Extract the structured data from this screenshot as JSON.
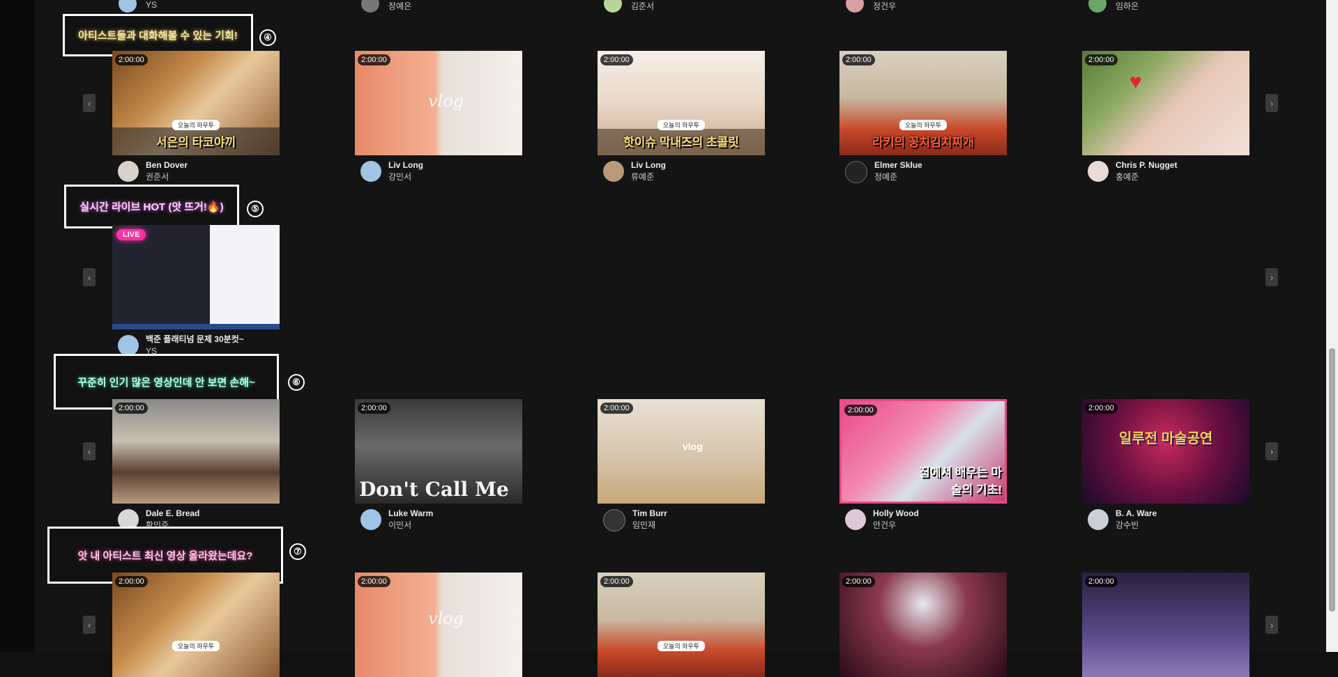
{
  "top_row": {
    "artists": [
      "YS",
      "장예은",
      "김준서",
      "정건우",
      "임하은"
    ]
  },
  "rows": [
    {
      "number": "④",
      "title": "아티스트들과 대화해볼 수 있는 기회!",
      "title_color": "#f6e9a8",
      "cards": [
        {
          "duration": "2:00:00",
          "tag": "오늘의 하우투",
          "caption": "서은의 타코야끼",
          "user": "Ben Dover",
          "artist": "권준서"
        },
        {
          "duration": "2:00:00",
          "tag": "",
          "caption": "vlog",
          "user": "Liv Long",
          "artist": "강민서"
        },
        {
          "duration": "2:00:00",
          "tag": "오늘의 하우투",
          "caption": "핫이슈 막내즈의 초콜릿",
          "user": "Liv Long",
          "artist": "류예준"
        },
        {
          "duration": "2:00:00",
          "tag": "오늘의 하우투",
          "caption": "라키의 꽁치김치찌개",
          "user": "Elmer Sklue",
          "artist": "정예준"
        },
        {
          "duration": "2:00:00",
          "tag": "",
          "caption": "",
          "user": "Chris P. Nugget",
          "artist": "홍예준"
        }
      ]
    },
    {
      "number": "⑤",
      "title": "실시간 라이브 HOT (앗 뜨거!🔥)",
      "title_color": "#ffd6ff",
      "cards": [
        {
          "live": "LIVE",
          "user": "백준 플래티넘 문제 30분컷~",
          "artist": "YS"
        }
      ]
    },
    {
      "number": "⑥",
      "title": "꾸준히 인기 많은 영상인데 안 보면 손해~",
      "title_color": "#b8ffe6",
      "cards": [
        {
          "duration": "2:00:00",
          "caption": "",
          "user": "Dale E. Bread",
          "artist": "황민준"
        },
        {
          "duration": "2:00:00",
          "caption": "Don't Call Me",
          "user": "Luke Warm",
          "artist": "이민서"
        },
        {
          "duration": "2:00:00",
          "caption": "vlog",
          "user": "Tim Burr",
          "artist": "임민재"
        },
        {
          "duration": "2:00:00",
          "caption": "집에서 배우는 마술의 기초!",
          "user": "Holly Wood",
          "artist": "안건우"
        },
        {
          "duration": "2:00:00",
          "caption": "일루전 마술공연",
          "user": "B. A. Ware",
          "artist": "강수빈"
        }
      ]
    },
    {
      "number": "⑦",
      "title": "앗 내 아티스트 최신 영상 올라왔는데요?",
      "title_color": "#ffc6ea",
      "cards": [
        {
          "duration": "2:00:00",
          "tag": "오늘의 하우투"
        },
        {
          "duration": "2:00:00",
          "caption": "vlog"
        },
        {
          "duration": "2:00:00",
          "tag": "오늘의 하우투"
        },
        {
          "duration": "2:00:00"
        },
        {
          "duration": "2:00:00"
        }
      ]
    }
  ],
  "nav": {
    "prev": "‹",
    "next": "›"
  }
}
